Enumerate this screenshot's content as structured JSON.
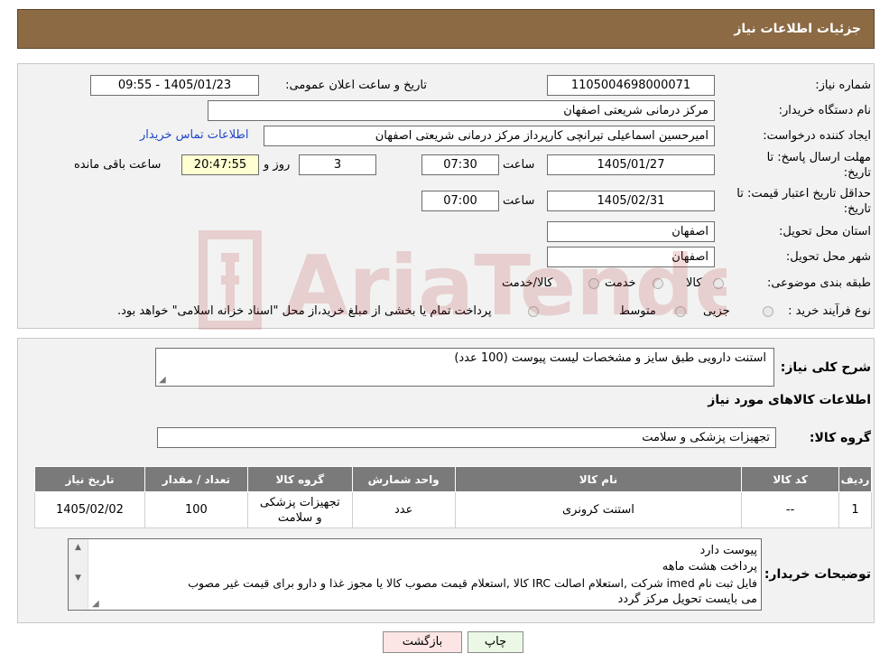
{
  "header": {
    "title": "جزئیات اطلاعات نیاز"
  },
  "form": {
    "need_number_label": "شماره نیاز:",
    "need_number": "1105004698000071",
    "announce_label": "تاریخ و ساعت اعلان عمومی:",
    "announce_value": "1405/01/23 - 09:55",
    "buyer_org_label": "نام دستگاه خریدار:",
    "buyer_org": "مرکز درمانی شریعتی اصفهان",
    "creator_label": "ایجاد کننده درخواست:",
    "creator": "امیرحسین اسماعیلی تیرانچی کارپرداز مرکز درمانی شریعتی اصفهان",
    "contact_link": "اطلاعات تماس خریدار",
    "reply_deadline_label": "مهلت ارسال پاسخ: تا تاریخ:",
    "reply_date": "1405/01/27",
    "time_label": "ساعت",
    "reply_time": "07:30",
    "days": "3",
    "days_label": "روز و",
    "remaining_time": "20:47:55",
    "remaining_label": "ساعت باقی مانده",
    "price_validity_label": "حداقل تاریخ اعتبار قیمت: تا تاریخ:",
    "price_date": "1405/02/31",
    "price_time": "07:00",
    "province_label": "استان محل تحویل:",
    "province": "اصفهان",
    "city_label": "شهر محل تحویل:",
    "city": "اصفهان",
    "category_label": "طبقه بندی موضوعی:",
    "category_options": [
      "کالا",
      "خدمت",
      "کالا/خدمت"
    ],
    "process_label": "نوع فرآیند خرید :",
    "process_options": [
      "جزیی",
      "متوسط"
    ],
    "process_note": "پرداخت تمام یا بخشی از مبلغ خرید،از محل \"اسناد خزانه اسلامی\" خواهد بود."
  },
  "details": {
    "summary_label": "شرح کلی نیاز:",
    "summary": "استنت دارویی طبق سایز و مشخصات لیست پیوست (100 عدد)",
    "goods_info_title": "اطلاعات کالاهای مورد نیاز",
    "goods_group_label": "گروه کالا:",
    "goods_group": "تجهیزات پزشکی و سلامت",
    "table": {
      "headers": [
        "ردیف",
        "کد کالا",
        "نام کالا",
        "واحد شمارش",
        "گروه کالا",
        "تعداد / مقدار",
        "تاریخ نیاز"
      ],
      "rows": [
        [
          "1",
          "--",
          "استنت کرونری",
          "عدد",
          "تجهیزات پزشکی و سلامت",
          "100",
          "1405/02/02"
        ]
      ]
    },
    "buyer_notes_label": "توضیحات خریدار:",
    "buyer_notes": [
      "پیوست دارد",
      "پرداخت هشت ماهه",
      "فایل ثبت نام imed شرکت ,استعلام اصالت IRC کالا ,استعلام قیمت مصوب کالا یا مجوز غذا و دارو برای قیمت غیر مصوب",
      "می بایست تحویل مرکز گردد"
    ]
  },
  "buttons": {
    "print": "چاپ",
    "back": "بازگشت"
  },
  "watermark": {
    "text": "AriaTender.neT"
  }
}
